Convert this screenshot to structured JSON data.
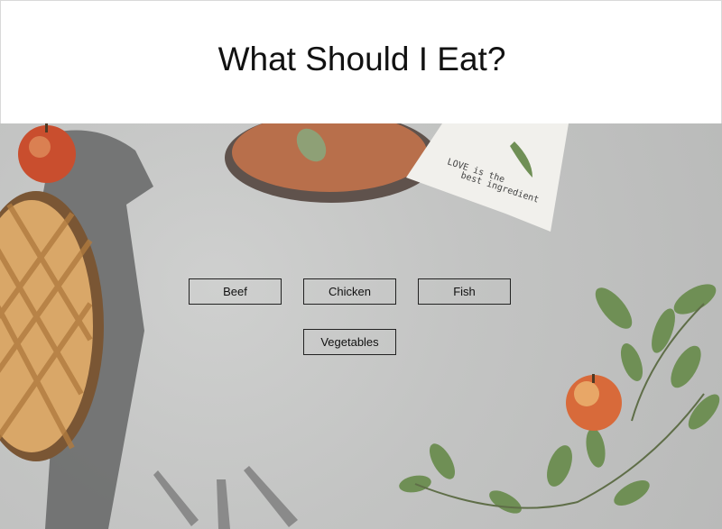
{
  "header": {
    "title": "What Should I Eat?"
  },
  "buttons": {
    "beef": "Beef",
    "chicken": "Chicken",
    "fish": "Fish",
    "vegetables": "Vegetables"
  },
  "napkin_text": {
    "line1": "LOVE is the",
    "line2": "best ingredient"
  },
  "colors": {
    "background": "#c3c4c3",
    "button_border": "#222222",
    "apple": "#c94e2e",
    "plate": "#b86f4b"
  }
}
